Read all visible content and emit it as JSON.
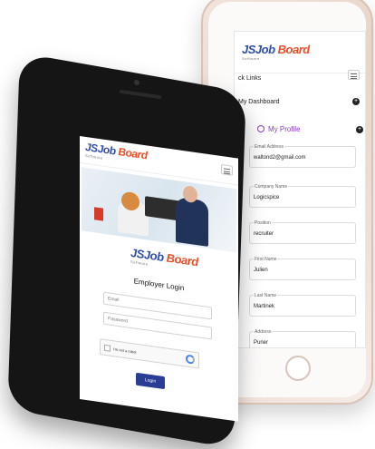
{
  "iphone": {
    "logo": {
      "js": "JS",
      "job": "Job",
      "board": "Board",
      "sub": "Software"
    },
    "quick_links": "ck Links",
    "dashboard": "My Dashboard",
    "profile": "My Profile",
    "fields": [
      {
        "label": "Email Address",
        "value": "waltond2@gmail.com"
      },
      {
        "label": "Company Name",
        "value": "Logicspice"
      },
      {
        "label": "Position",
        "value": "recruiter"
      },
      {
        "label": "First Name",
        "value": "Julien"
      },
      {
        "label": "Last Name",
        "value": "Martinek"
      },
      {
        "label": "Address",
        "value": "Puner"
      }
    ]
  },
  "android": {
    "logo": {
      "js": "JS",
      "job": "Job",
      "board": "Board",
      "sub": "Software"
    },
    "heading": "Employer Login",
    "email_placeholder": "Email",
    "password_placeholder": "Password",
    "captcha_label": "I'm not a robot",
    "login_label": "Login"
  },
  "colors": {
    "brand_blue": "#2f4fa8",
    "brand_orange": "#e8502a",
    "profile_purple": "#8a3fb8",
    "button_navy": "#2a3d96"
  }
}
